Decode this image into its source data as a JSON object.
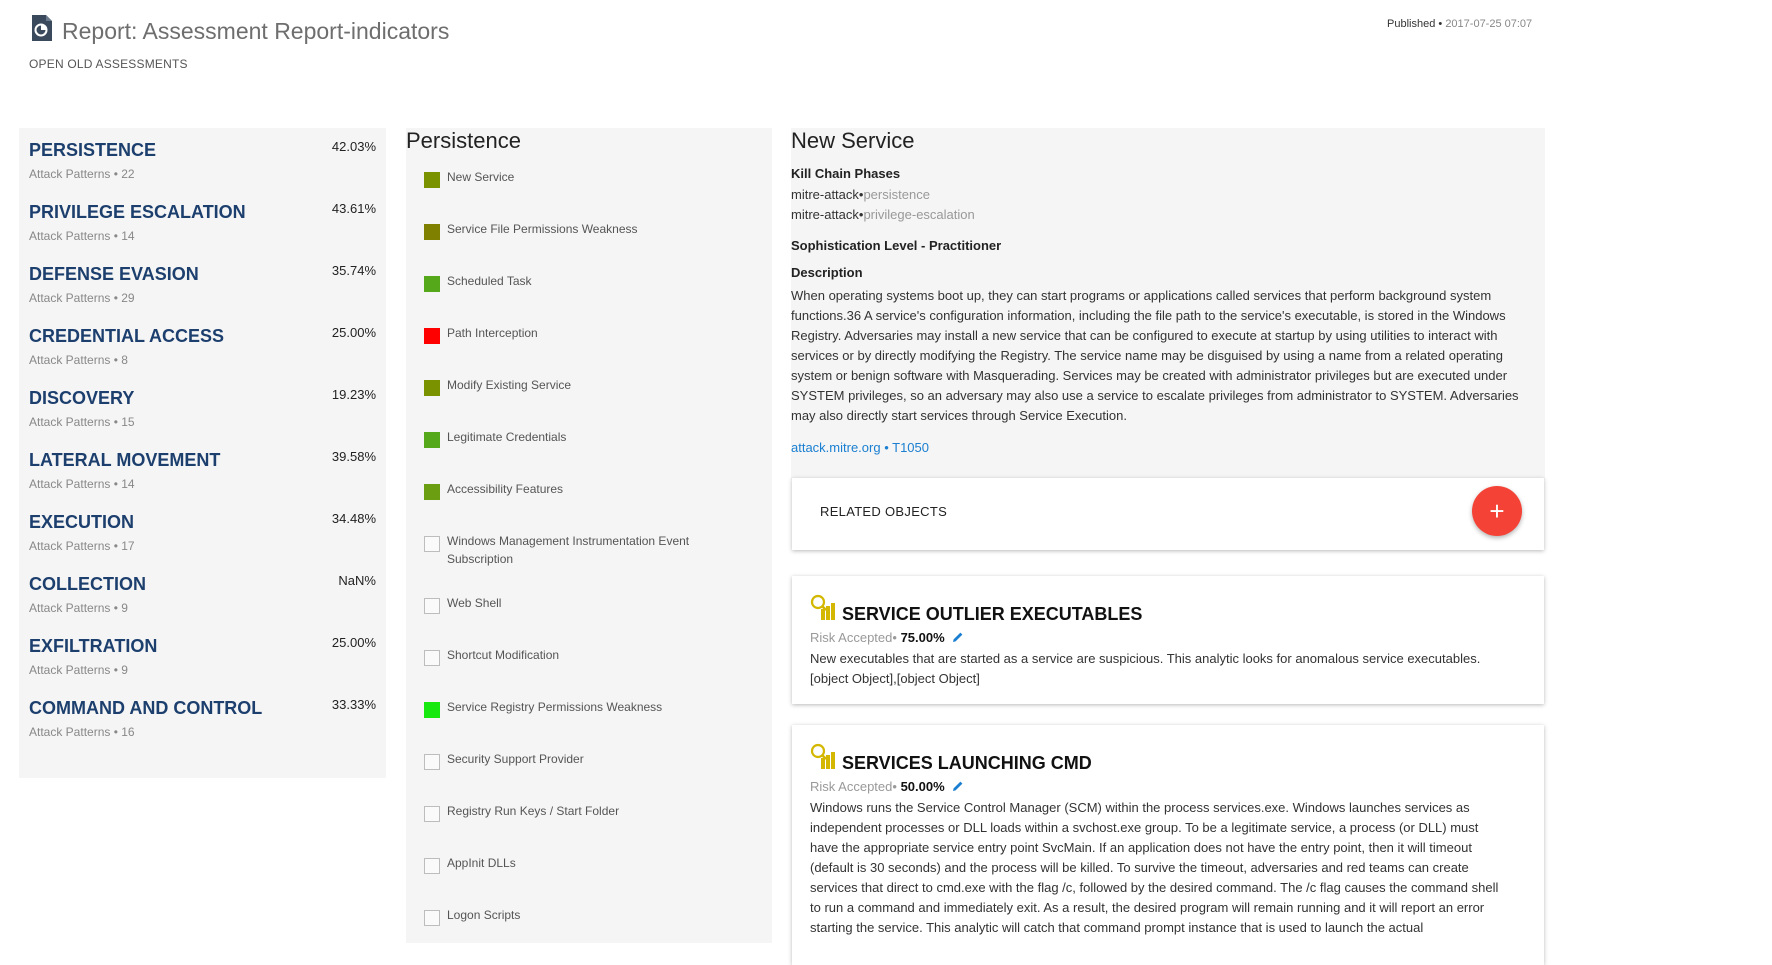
{
  "header": {
    "title": "Report: Assessment Report-indicators",
    "subnav": "OPEN OLD ASSESSMENTS",
    "published_label": "Published",
    "published_date": "2017-07-25 07:07"
  },
  "phases": [
    {
      "name": "PERSISTENCE",
      "count": "Attack Patterns • 22",
      "pct": "42.03%"
    },
    {
      "name": "PRIVILEGE ESCALATION",
      "count": "Attack Patterns • 14",
      "pct": "43.61%"
    },
    {
      "name": "DEFENSE EVASION",
      "count": "Attack Patterns • 29",
      "pct": "35.74%"
    },
    {
      "name": "CREDENTIAL ACCESS",
      "count": "Attack Patterns • 8",
      "pct": "25.00%"
    },
    {
      "name": "DISCOVERY",
      "count": "Attack Patterns • 15",
      "pct": "19.23%"
    },
    {
      "name": "LATERAL MOVEMENT",
      "count": "Attack Patterns • 14",
      "pct": "39.58%"
    },
    {
      "name": "EXECUTION",
      "count": "Attack Patterns • 17",
      "pct": "34.48%"
    },
    {
      "name": "COLLECTION",
      "count": "Attack Patterns • 9",
      "pct": "NaN%"
    },
    {
      "name": "EXFILTRATION",
      "count": "Attack Patterns • 9",
      "pct": "25.00%"
    },
    {
      "name": "COMMAND AND CONTROL",
      "count": "Attack Patterns • 16",
      "pct": "33.33%"
    }
  ],
  "patterns": {
    "title": "Persistence",
    "items": [
      {
        "label": "New Service",
        "color": "#7a9100"
      },
      {
        "label": "Service File Permissions Weakness",
        "color": "#808000"
      },
      {
        "label": "Scheduled Task",
        "color": "#56a81b"
      },
      {
        "label": "Path Interception",
        "color": "#ff0000"
      },
      {
        "label": "Modify Existing Service",
        "color": "#7a9100"
      },
      {
        "label": "Legitimate Credentials",
        "color": "#56a81b"
      },
      {
        "label": "Accessibility Features",
        "color": "#6b9e10"
      },
      {
        "label": "Windows Management Instrumentation Event Subscription",
        "color": ""
      },
      {
        "label": "Web Shell",
        "color": ""
      },
      {
        "label": "Shortcut Modification",
        "color": ""
      },
      {
        "label": "Service Registry Permissions Weakness",
        "color": "#17e80f"
      },
      {
        "label": "Security Support Provider",
        "color": ""
      },
      {
        "label": "Registry Run Keys / Start Folder",
        "color": ""
      },
      {
        "label": "AppInit DLLs",
        "color": ""
      },
      {
        "label": "Logon Scripts",
        "color": ""
      }
    ]
  },
  "detail": {
    "title": "New Service",
    "kill_chain_heading": "Kill Chain Phases",
    "kill_chain": [
      {
        "source": "mitre-attack•",
        "phase": "persistence"
      },
      {
        "source": "mitre-attack•",
        "phase": "privilege-escalation"
      }
    ],
    "sophistication": "Sophistication Level - Practitioner",
    "description_heading": "Description",
    "description": "When operating systems boot up, they can start programs or applications called services that perform background system functions.36 A service's configuration information, including the file path to the service's executable, is stored in the Windows Registry. Adversaries may install a new service that can be configured to execute at startup by using utilities to interact with services or by directly modifying the Registry. The service name may be disguised by using a name from a related operating system or benign software with Masquerading. Services may be created with administrator privileges but are executed under SYSTEM privileges, so an adversary may also use a service to escalate privileges from administrator to SYSTEM. Adversaries may also directly start services through Service Execution.",
    "link": "attack.mitre.org • T1050"
  },
  "related": {
    "label": "RELATED OBJECTS",
    "add_symbol": "+"
  },
  "analytics": [
    {
      "title": "SERVICE OUTLIER EXECUTABLES",
      "risk_label": "Risk Accepted•",
      "risk_value": "75.00%",
      "description": "New executables that are started as a service are suspicious. This analytic looks for anomalous service executables. [object Object],[object Object]"
    },
    {
      "title": "SERVICES LAUNCHING CMD",
      "risk_label": "Risk Accepted•",
      "risk_value": "50.00%",
      "description": "Windows runs the Service Control Manager (SCM) within the process services.exe. Windows launches services as independent processes or DLL loads within a svchost.exe group. To be a legitimate service, a process (or DLL) must have the appropriate service entry point SvcMain. If an application does not have the entry point, then it will timeout (default is 30 seconds) and the process will be killed. To survive the timeout, adversaries and red teams can create services that direct to cmd.exe with the flag /c, followed by the desired command. The /c flag causes the command shell to run a command and immediately exit. As a result, the desired program will remain running and it will report an error starting the service. This analytic will catch that command prompt instance that is used to launch the actual"
    }
  ],
  "colors": {
    "phase_name": "#1c3f6e",
    "link": "#1a7fd1",
    "fab": "#f44336",
    "analytic_icon": "#d4b700"
  },
  "icons": {
    "report": "report-document-icon",
    "add": "plus-icon",
    "analytic": "magnifier-bar-chart-icon",
    "edit": "pencil-icon"
  }
}
